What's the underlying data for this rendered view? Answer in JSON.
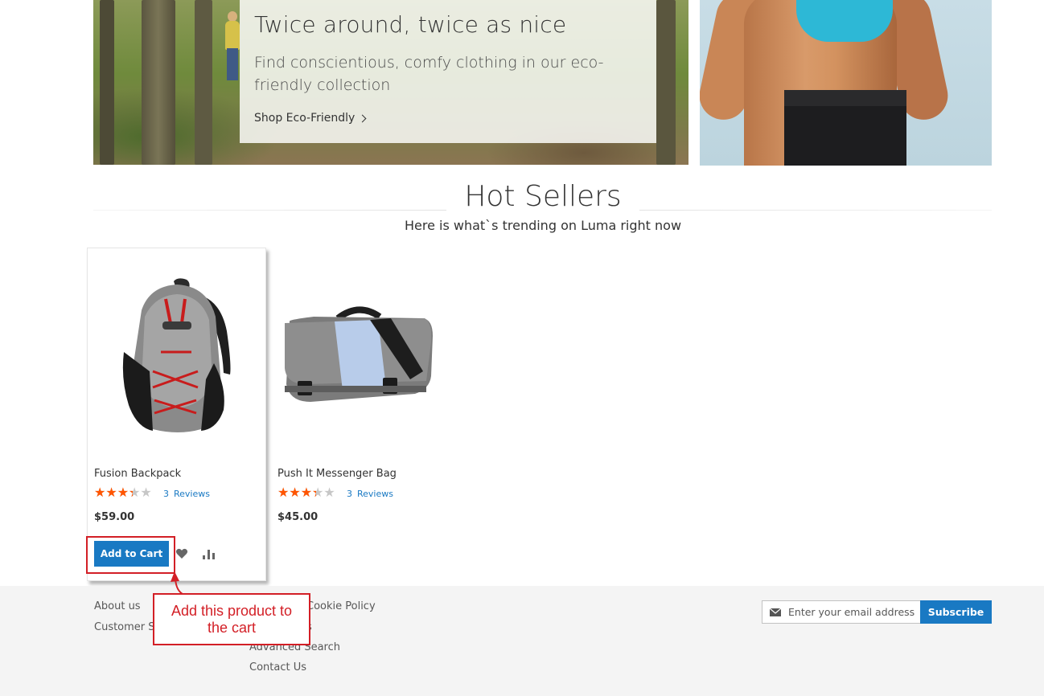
{
  "promo": {
    "title": "Twice around, twice as nice",
    "text": "Find conscientious, comfy clothing in our eco-friendly collection",
    "link_label": "Shop Eco-Friendly"
  },
  "section": {
    "title": "Hot Sellers",
    "subtitle": "Here is what`s trending on Luma right now"
  },
  "products": [
    {
      "name": "Fusion Backpack",
      "rating_fraction": 0.67,
      "review_count": "3",
      "reviews_label": "Reviews",
      "price": "$59.00",
      "add_to_cart_label": "Add to Cart",
      "image_icon": "backpack-icon"
    },
    {
      "name": "Push It Messenger Bag",
      "rating_fraction": 0.67,
      "review_count": "3",
      "reviews_label": "Reviews",
      "price": "$45.00",
      "image_icon": "messenger-bag-icon"
    }
  ],
  "footer": {
    "links_col1": [
      "About us",
      "Customer Se"
    ],
    "links_col2": [
      "Cookie Policy",
      "s",
      "Advanced Search",
      "Contact Us"
    ],
    "newsletter_placeholder": "Enter your email address",
    "subscribe_label": "Subscribe"
  },
  "annotation": {
    "callout_text": "Add this product to the cart"
  },
  "colors": {
    "accent": "#1979c3",
    "star": "#ff5501",
    "annotation": "#d31f26"
  }
}
